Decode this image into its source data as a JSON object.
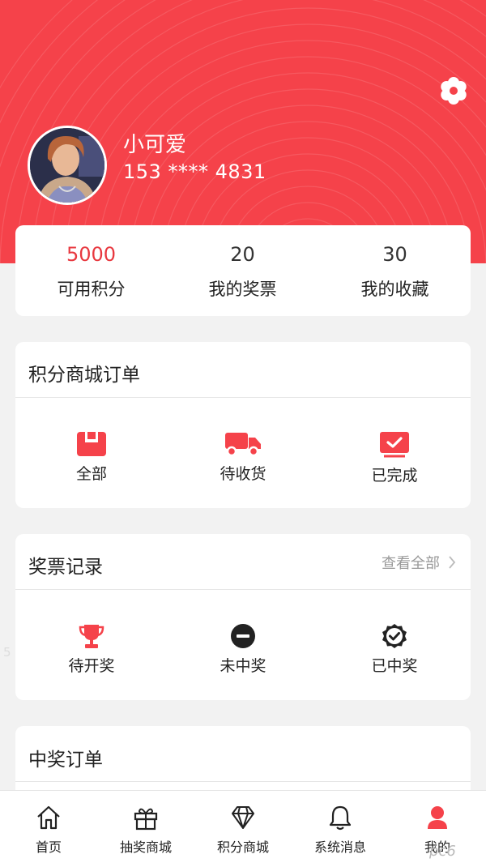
{
  "colors": {
    "accent": "#f5424a",
    "accent_text": "#e8383f"
  },
  "profile": {
    "name": "小可爱",
    "phone": "153 **** 4831",
    "settings_icon": "gear-icon"
  },
  "stats": [
    {
      "value": "5000",
      "label": "可用积分"
    },
    {
      "value": "20",
      "label": "我的奖票"
    },
    {
      "value": "30",
      "label": "我的收藏"
    }
  ],
  "orders": {
    "title": "积分商城订单",
    "items": [
      {
        "label": "全部",
        "icon": "box-icon"
      },
      {
        "label": "待收货",
        "icon": "truck-icon"
      },
      {
        "label": "已完成",
        "icon": "check-box-icon"
      }
    ]
  },
  "tickets": {
    "title": "奖票记录",
    "view_all": "查看全部",
    "items": [
      {
        "label": "待开奖",
        "icon": "trophy-icon"
      },
      {
        "label": "未中奖",
        "icon": "minus-circle-icon"
      },
      {
        "label": "已中奖",
        "icon": "verified-badge-icon"
      }
    ]
  },
  "winning": {
    "title": "中奖订单"
  },
  "tabbar": [
    {
      "label": "首页",
      "icon": "home-icon"
    },
    {
      "label": "抽奖商城",
      "icon": "gift-icon"
    },
    {
      "label": "积分商城",
      "icon": "diamond-icon"
    },
    {
      "label": "系统消息",
      "icon": "bell-icon"
    },
    {
      "label": "我的",
      "icon": "user-icon"
    }
  ],
  "watermark": "pc6",
  "edge_mark": "5"
}
